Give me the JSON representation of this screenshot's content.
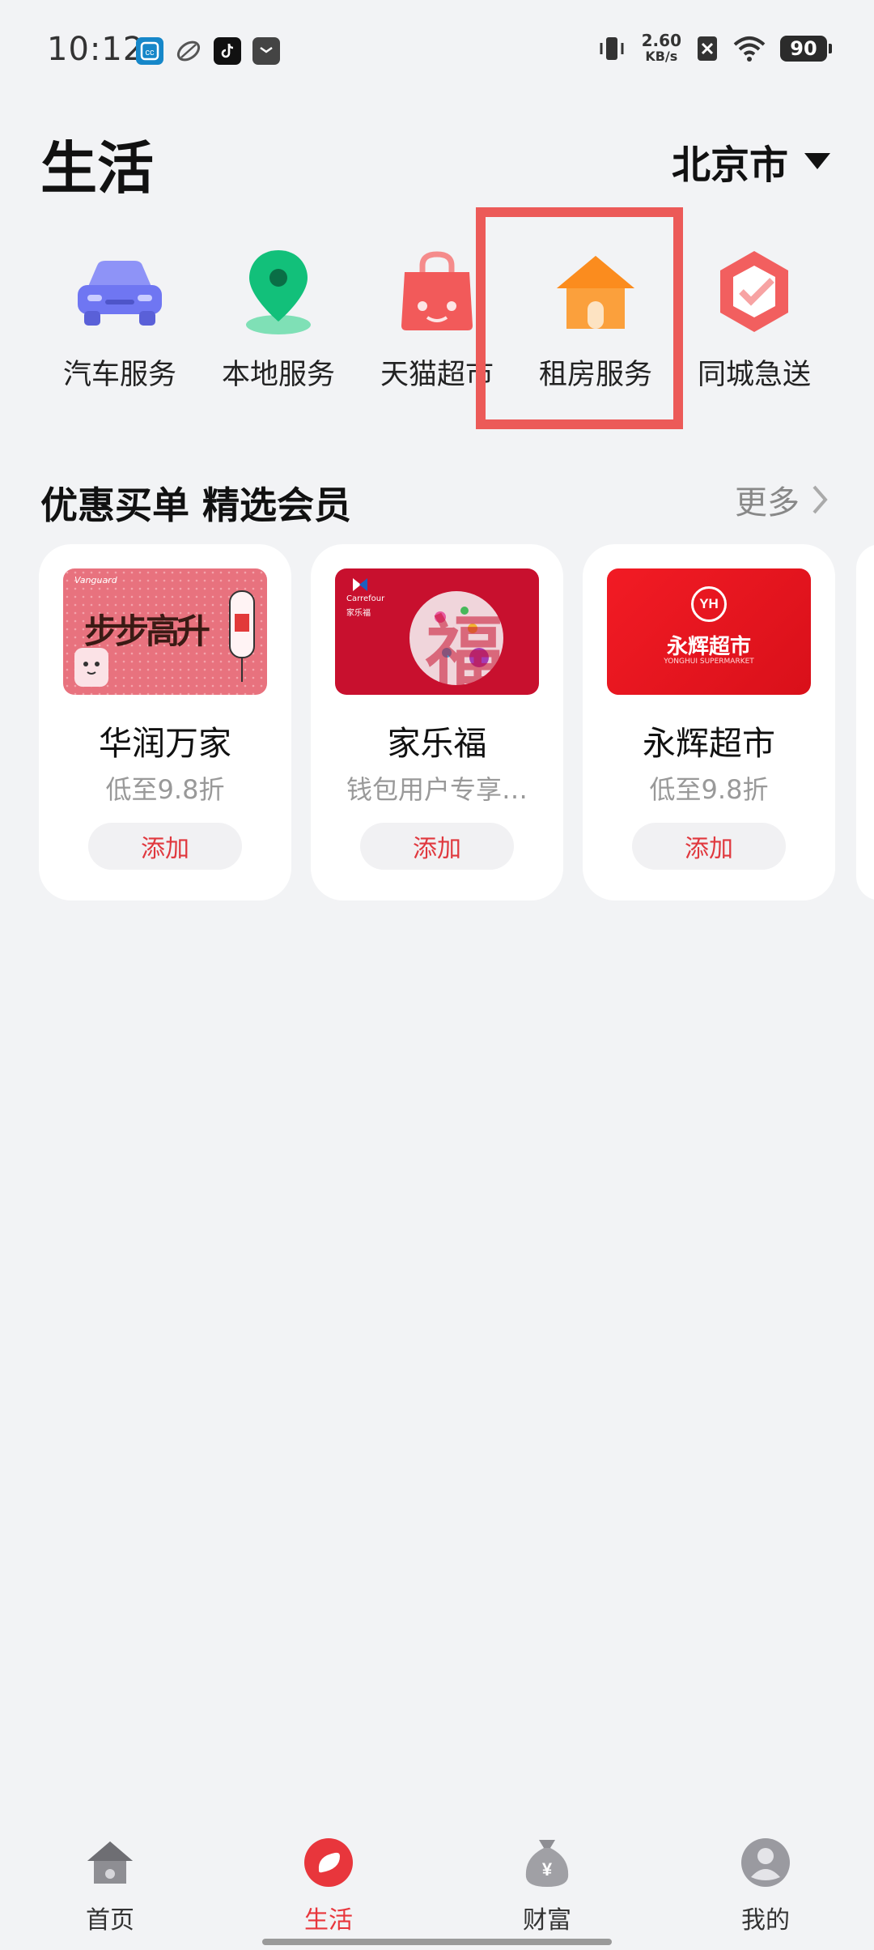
{
  "status_bar": {
    "time": "10:12",
    "net_speed_value": "2.60",
    "net_speed_unit": "KB/s",
    "battery": "90"
  },
  "header": {
    "title": "生活",
    "city": "北京市"
  },
  "services": [
    {
      "label": "汽车服务",
      "icon": "car-icon"
    },
    {
      "label": "本地服务",
      "icon": "location-pin-icon"
    },
    {
      "label": "天猫超市",
      "icon": "shopping-bag-icon"
    },
    {
      "label": "租房服务",
      "icon": "house-icon"
    },
    {
      "label": "同城急送",
      "icon": "delivery-cube-icon"
    }
  ],
  "section": {
    "title": "优惠买单 精选会员",
    "more_label": "更多"
  },
  "cards": [
    {
      "name": "华润万家",
      "desc": "低至9.8折",
      "add_label": "添加",
      "brand_text": "Vanguard",
      "art_text": "步步高升"
    },
    {
      "name": "家乐福",
      "desc": "钱包用户专享…",
      "add_label": "添加",
      "brand_text": "Carrefour",
      "brand_sub": "家乐福",
      "art_text": "福"
    },
    {
      "name": "永辉超市",
      "desc": "低至9.8折",
      "add_label": "添加",
      "logo_text": "YH",
      "brand_text": "永辉超市",
      "brand_sub": "YONGHUI SUPERMARKET"
    }
  ],
  "bottom_nav": [
    {
      "label": "首页",
      "icon": "home-icon",
      "active": false
    },
    {
      "label": "生活",
      "icon": "life-icon",
      "active": true
    },
    {
      "label": "财富",
      "icon": "money-bag-icon",
      "active": false
    },
    {
      "label": "我的",
      "icon": "profile-icon",
      "active": false
    }
  ],
  "colors": {
    "accent": "#e8363c",
    "highlight": "#ec5a58",
    "background": "#f2f3f5"
  }
}
